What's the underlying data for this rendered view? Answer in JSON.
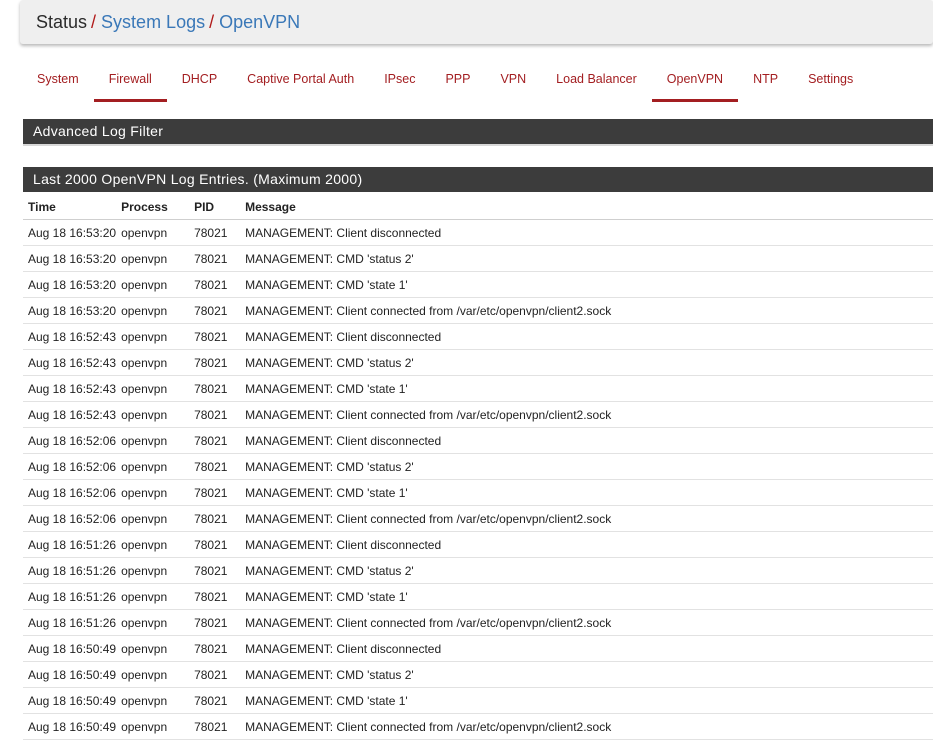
{
  "breadcrumb": {
    "root": "Status",
    "parent": "System Logs",
    "current": "OpenVPN",
    "separator": "/"
  },
  "tabs": [
    {
      "label": "System",
      "active": false
    },
    {
      "label": "Firewall",
      "active": true
    },
    {
      "label": "DHCP",
      "active": false
    },
    {
      "label": "Captive Portal Auth",
      "active": false
    },
    {
      "label": "IPsec",
      "active": false
    },
    {
      "label": "PPP",
      "active": false
    },
    {
      "label": "VPN",
      "active": false
    },
    {
      "label": "Load Balancer",
      "active": false
    },
    {
      "label": "OpenVPN",
      "active": true
    },
    {
      "label": "NTP",
      "active": false
    },
    {
      "label": "Settings",
      "active": false
    }
  ],
  "filter_panel": {
    "title": "Advanced Log Filter"
  },
  "log_panel": {
    "title": "Last 2000 OpenVPN Log Entries. (Maximum 2000)"
  },
  "table": {
    "headers": {
      "time": "Time",
      "process": "Process",
      "pid": "PID",
      "message": "Message"
    },
    "rows": [
      {
        "time": "Aug 18 16:53:20",
        "process": "openvpn",
        "pid": "78021",
        "message": "MANAGEMENT: Client disconnected"
      },
      {
        "time": "Aug 18 16:53:20",
        "process": "openvpn",
        "pid": "78021",
        "message": "MANAGEMENT: CMD 'status 2'"
      },
      {
        "time": "Aug 18 16:53:20",
        "process": "openvpn",
        "pid": "78021",
        "message": "MANAGEMENT: CMD 'state 1'"
      },
      {
        "time": "Aug 18 16:53:20",
        "process": "openvpn",
        "pid": "78021",
        "message": "MANAGEMENT: Client connected from /var/etc/openvpn/client2.sock"
      },
      {
        "time": "Aug 18 16:52:43",
        "process": "openvpn",
        "pid": "78021",
        "message": "MANAGEMENT: Client disconnected"
      },
      {
        "time": "Aug 18 16:52:43",
        "process": "openvpn",
        "pid": "78021",
        "message": "MANAGEMENT: CMD 'status 2'"
      },
      {
        "time": "Aug 18 16:52:43",
        "process": "openvpn",
        "pid": "78021",
        "message": "MANAGEMENT: CMD 'state 1'"
      },
      {
        "time": "Aug 18 16:52:43",
        "process": "openvpn",
        "pid": "78021",
        "message": "MANAGEMENT: Client connected from /var/etc/openvpn/client2.sock"
      },
      {
        "time": "Aug 18 16:52:06",
        "process": "openvpn",
        "pid": "78021",
        "message": "MANAGEMENT: Client disconnected"
      },
      {
        "time": "Aug 18 16:52:06",
        "process": "openvpn",
        "pid": "78021",
        "message": "MANAGEMENT: CMD 'status 2'"
      },
      {
        "time": "Aug 18 16:52:06",
        "process": "openvpn",
        "pid": "78021",
        "message": "MANAGEMENT: CMD 'state 1'"
      },
      {
        "time": "Aug 18 16:52:06",
        "process": "openvpn",
        "pid": "78021",
        "message": "MANAGEMENT: Client connected from /var/etc/openvpn/client2.sock"
      },
      {
        "time": "Aug 18 16:51:26",
        "process": "openvpn",
        "pid": "78021",
        "message": "MANAGEMENT: Client disconnected"
      },
      {
        "time": "Aug 18 16:51:26",
        "process": "openvpn",
        "pid": "78021",
        "message": "MANAGEMENT: CMD 'status 2'"
      },
      {
        "time": "Aug 18 16:51:26",
        "process": "openvpn",
        "pid": "78021",
        "message": "MANAGEMENT: CMD 'state 1'"
      },
      {
        "time": "Aug 18 16:51:26",
        "process": "openvpn",
        "pid": "78021",
        "message": "MANAGEMENT: Client connected from /var/etc/openvpn/client2.sock"
      },
      {
        "time": "Aug 18 16:50:49",
        "process": "openvpn",
        "pid": "78021",
        "message": "MANAGEMENT: Client disconnected"
      },
      {
        "time": "Aug 18 16:50:49",
        "process": "openvpn",
        "pid": "78021",
        "message": "MANAGEMENT: CMD 'status 2'"
      },
      {
        "time": "Aug 18 16:50:49",
        "process": "openvpn",
        "pid": "78021",
        "message": "MANAGEMENT: CMD 'state 1'"
      },
      {
        "time": "Aug 18 16:50:49",
        "process": "openvpn",
        "pid": "78021",
        "message": "MANAGEMENT: Client connected from /var/etc/openvpn/client2.sock"
      }
    ]
  },
  "colors": {
    "tab_text": "#a31e21",
    "link_blue": "#3a78b8",
    "separator_red": "#b11a1a",
    "panel_heading_bg": "#3c3c3c"
  }
}
